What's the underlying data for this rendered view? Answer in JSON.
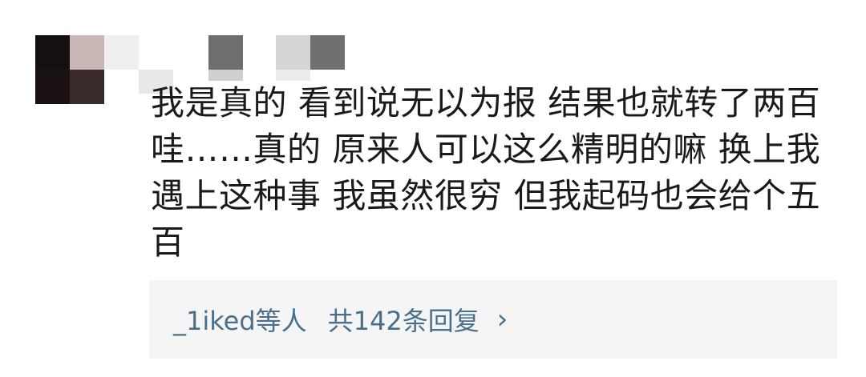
{
  "comment": {
    "text": "我是真的 看到说无以为报 结果也就转了两百 哇……真的 原来人可以这么精明的嘛 换上我遇上这种事 我虽然很穷 但我起码也会给个五百"
  },
  "replies": {
    "users_label": "_1iked等人",
    "count_label": "共142条回复",
    "chevron_icon": "chevron-right-icon"
  },
  "colors": {
    "link": "#4a6f8a",
    "reply_bg": "#f5f5f5",
    "text": "#1a1a1a"
  }
}
